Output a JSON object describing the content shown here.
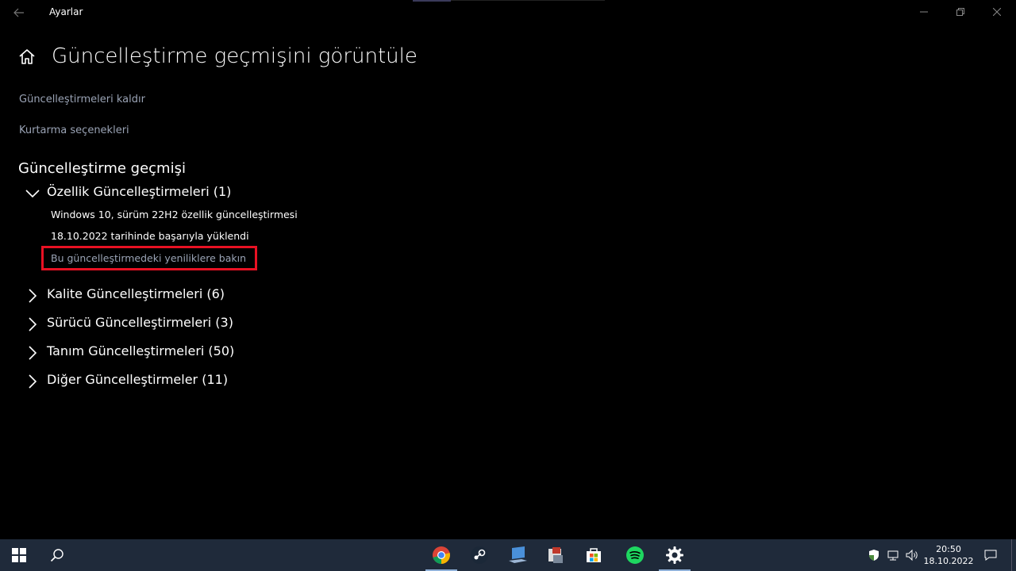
{
  "window": {
    "title": "Ayarlar",
    "controls": {
      "minimize": "minimize-icon",
      "maximize": "restore-icon",
      "close": "close-icon"
    }
  },
  "page": {
    "title": "Güncelleştirme geçmişini görüntüle",
    "links": {
      "uninstall": "Güncelleştirmeleri kaldır",
      "recovery": "Kurtarma seçenekleri"
    },
    "history_title": "Güncelleştirme geçmişi",
    "groups": [
      {
        "label": "Özellik Güncelleştirmeleri (1)",
        "expanded": true
      },
      {
        "label": "Kalite Güncelleştirmeleri (6)",
        "expanded": false
      },
      {
        "label": "Sürücü Güncelleştirmeleri (3)",
        "expanded": false
      },
      {
        "label": "Tanım Güncelleştirmeleri (50)",
        "expanded": false
      },
      {
        "label": "Diğer Güncelleştirmeler (11)",
        "expanded": false
      }
    ],
    "feature_update": {
      "name": "Windows 10, sürüm 22H2 özellik güncelleştirmesi",
      "status": "18.10.2022 tarihinde başarıyla yüklendi",
      "whats_new_link": "Bu güncelleştirmedeki yeniliklere bakın"
    }
  },
  "taskbar": {
    "apps": [
      "chrome-icon",
      "steam-icon",
      "laptop-app-icon",
      "media-app-icon",
      "store-icon",
      "spotify-icon",
      "settings-icon"
    ],
    "active_app": "settings-icon",
    "clock": {
      "time": "20:50",
      "date": "18.10.2022"
    }
  },
  "colors": {
    "background": "#000000",
    "link": "#9aa3b5",
    "highlight": "#e81123",
    "taskbar": "#1f2a3a"
  }
}
